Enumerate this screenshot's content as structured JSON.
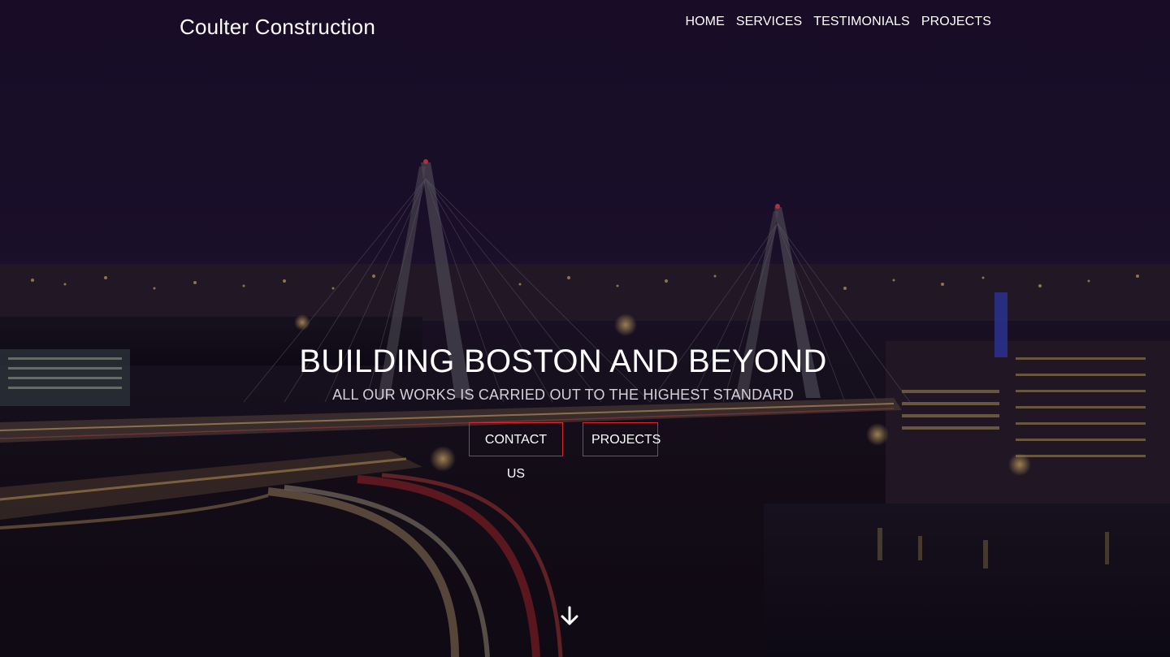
{
  "brand": {
    "name": "Coulter Construction"
  },
  "nav": {
    "items": [
      {
        "label": "HOME"
      },
      {
        "label": "SERVICES"
      },
      {
        "label": "TESTIMONIALS"
      },
      {
        "label": "PROJECTS"
      }
    ]
  },
  "hero": {
    "title": "BUILDING BOSTON AND BEYOND",
    "subtitle": "ALL OUR WORKS IS CARRIED OUT TO THE HIGHEST STANDARD",
    "buttons": {
      "contact_label": "CONTACT US",
      "projects_label": "PROJECTS"
    },
    "scroll_icon": "arrow-down-icon",
    "background_image": "night-city-bridge-photo"
  },
  "colors": {
    "accent": "#e0232c",
    "text": "#ffffff",
    "overlay": "#1c0f2c"
  }
}
